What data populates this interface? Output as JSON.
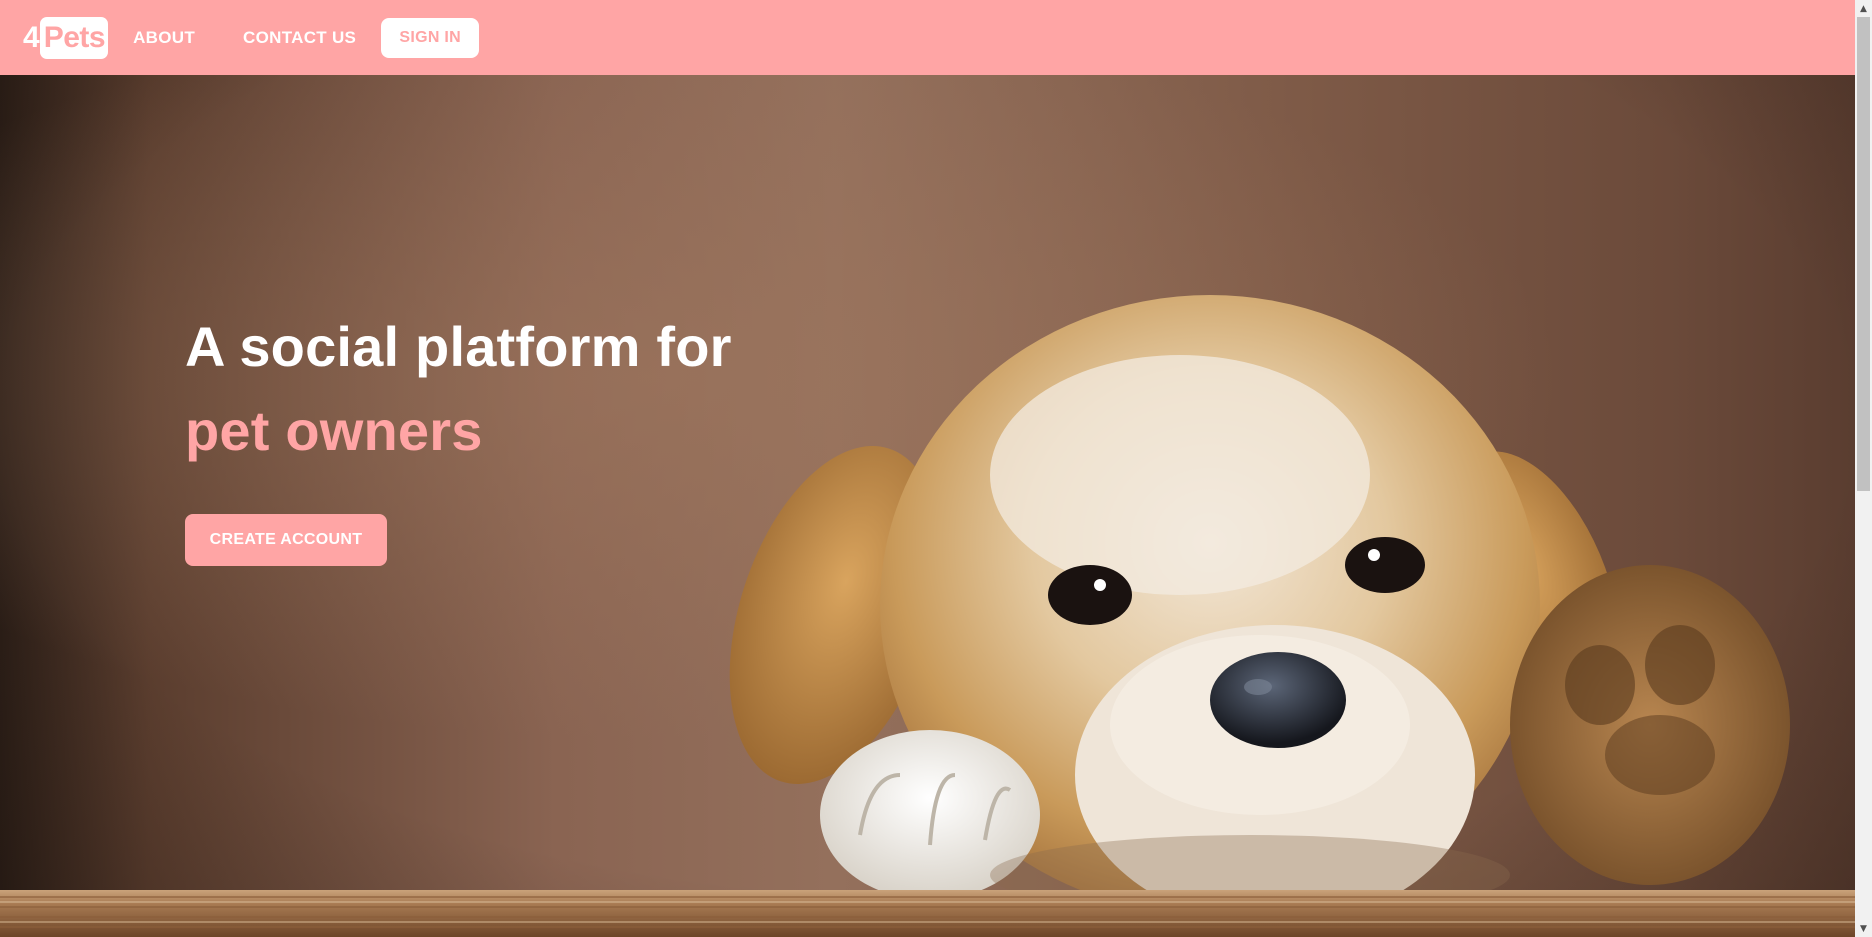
{
  "navbar": {
    "logo_number": "4",
    "logo_word": "Pets",
    "links": {
      "about": "ABOUT",
      "contact": "CONTACT US"
    },
    "signin_label": "SIGN IN"
  },
  "hero": {
    "headline_line1": "A social platform for",
    "headline_line2": "pet owners",
    "cta_label": "CREATE ACCOUNT",
    "image_subject": "golden retriever puppy resting on wooden ledge"
  },
  "colors": {
    "brand_pink": "#ffa5a5",
    "white": "#ffffff"
  },
  "icons": {
    "scroll_up": "scroll-up-arrow-icon",
    "scroll_down": "scroll-down-arrow-icon"
  }
}
